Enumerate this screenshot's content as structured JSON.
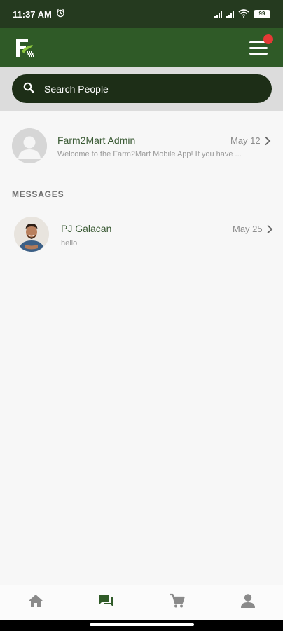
{
  "status_bar": {
    "time": "11:37 AM",
    "battery": "99"
  },
  "app_bar": {
    "logo_icon": "farm2mart-logo",
    "menu_icon": "hamburger-menu-icon",
    "notification_color": "#e53935"
  },
  "search": {
    "placeholder": "Search People"
  },
  "pinned_chat": {
    "name": "Farm2Mart Admin",
    "preview": "Welcome to the Farm2Mart Mobile App! If you have ...",
    "date": "May 12"
  },
  "messages": {
    "section_label": "MESSAGES",
    "items": [
      {
        "name": "PJ Galacan",
        "preview": "hello",
        "date": "May 25"
      }
    ]
  },
  "bottom_nav": {
    "items": [
      {
        "icon": "home-icon",
        "active": false
      },
      {
        "icon": "chat-icon",
        "active": true
      },
      {
        "icon": "cart-icon",
        "active": false
      },
      {
        "icon": "profile-icon",
        "active": false
      }
    ]
  },
  "colors": {
    "primary": "#2f5a27",
    "status_bar": "#253a1f",
    "search_bg": "#1d2e17",
    "active_nav": "#2f5a27",
    "inactive_nav": "#8a8a8a"
  }
}
